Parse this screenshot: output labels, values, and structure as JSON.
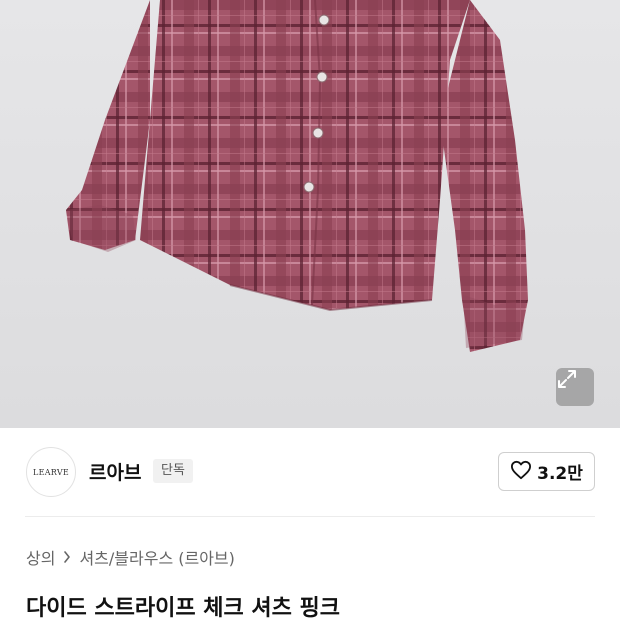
{
  "brand": {
    "logo_text": "LEARVE",
    "name": "르아브",
    "badge": "단독"
  },
  "like": {
    "count": "3.2만"
  },
  "breadcrumb": {
    "category": "상의",
    "subcategory": "셔츠/블라우스 (르아브)"
  },
  "product": {
    "title": "다이드 스트라이프 체크 셔츠 핑크"
  },
  "colors": {
    "shirt": "#9c4f60",
    "hero_bg": "#e0e0e2",
    "badge_bg": "#f1f1f1"
  }
}
